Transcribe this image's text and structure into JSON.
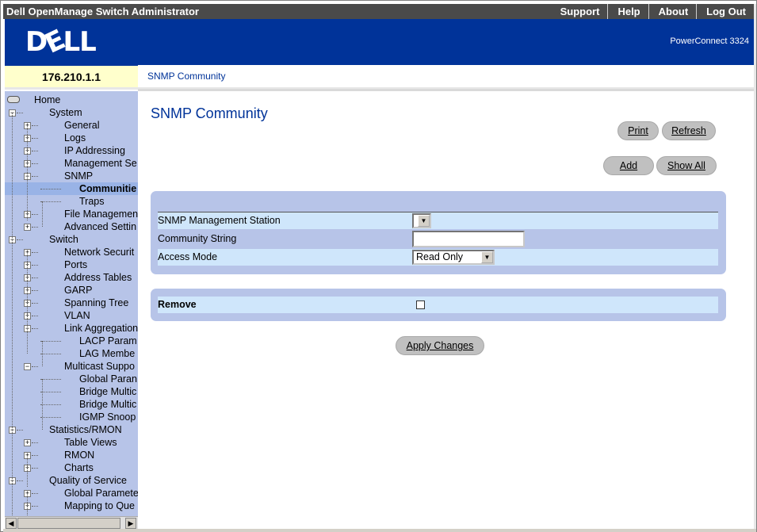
{
  "window": {
    "title": "Dell OpenManage Switch Administrator"
  },
  "topnav": [
    "Support",
    "Help",
    "About",
    "Log Out"
  ],
  "banner": {
    "logo": "DELL",
    "product": "PowerConnect 3324"
  },
  "header": {
    "ip": "176.210.1.1",
    "breadcrumb": "SNMP Community"
  },
  "tree": [
    {
      "label": "Home",
      "level": 0,
      "exp": "",
      "icon": "home-icon"
    },
    {
      "label": "System",
      "level": 1,
      "exp": "-"
    },
    {
      "label": "General",
      "level": 2,
      "exp": "+"
    },
    {
      "label": "Logs",
      "level": 2,
      "exp": "+"
    },
    {
      "label": "IP Addressing",
      "level": 2,
      "exp": "+"
    },
    {
      "label": "Management Se",
      "level": 2,
      "exp": "+"
    },
    {
      "label": "SNMP",
      "level": 2,
      "exp": "-"
    },
    {
      "label": "Communitie",
      "level": 3,
      "exp": "",
      "selected": true
    },
    {
      "label": "Traps",
      "level": 3,
      "exp": ""
    },
    {
      "label": "File Managemen",
      "level": 2,
      "exp": "+"
    },
    {
      "label": "Advanced Settin",
      "level": 2,
      "exp": "+"
    },
    {
      "label": "Switch",
      "level": 1,
      "exp": "-"
    },
    {
      "label": "Network Securit",
      "level": 2,
      "exp": "+"
    },
    {
      "label": "Ports",
      "level": 2,
      "exp": "+"
    },
    {
      "label": "Address Tables",
      "level": 2,
      "exp": "+"
    },
    {
      "label": "GARP",
      "level": 2,
      "exp": "+"
    },
    {
      "label": "Spanning Tree",
      "level": 2,
      "exp": "+"
    },
    {
      "label": "VLAN",
      "level": 2,
      "exp": "+"
    },
    {
      "label": "Link Aggregation",
      "level": 2,
      "exp": "-"
    },
    {
      "label": "LACP Param",
      "level": 3,
      "exp": ""
    },
    {
      "label": "LAG Membe",
      "level": 3,
      "exp": ""
    },
    {
      "label": "Multicast Suppo",
      "level": 2,
      "exp": "-"
    },
    {
      "label": "Global Paran",
      "level": 3,
      "exp": ""
    },
    {
      "label": "Bridge Multic",
      "level": 3,
      "exp": ""
    },
    {
      "label": "Bridge Multic",
      "level": 3,
      "exp": ""
    },
    {
      "label": "IGMP Snoop",
      "level": 3,
      "exp": ""
    },
    {
      "label": "Statistics/RMON",
      "level": 1,
      "exp": "-"
    },
    {
      "label": "Table Views",
      "level": 2,
      "exp": "+"
    },
    {
      "label": "RMON",
      "level": 2,
      "exp": "+"
    },
    {
      "label": "Charts",
      "level": 2,
      "exp": "+"
    },
    {
      "label": "Quality of Service",
      "level": 1,
      "exp": "-"
    },
    {
      "label": "Global Paramete",
      "level": 2,
      "exp": "+"
    },
    {
      "label": "Mapping to Que",
      "level": 2,
      "exp": "+"
    }
  ],
  "page": {
    "title": "SNMP Community",
    "buttons": {
      "print": "Print",
      "refresh": "Refresh",
      "add": "Add",
      "show_all": "Show All",
      "apply": "Apply Changes"
    },
    "form": {
      "station_label": "SNMP Management Station",
      "station_value": "",
      "community_label": "Community String",
      "community_value": "",
      "access_label": "Access Mode",
      "access_value": "Read Only",
      "remove_label": "Remove",
      "remove_checked": false
    }
  },
  "colors": {
    "banner": "#003399",
    "sidebar": "#b7c4e8",
    "field_row": "#cfe6fb",
    "ip_bg": "#ffffcc"
  }
}
